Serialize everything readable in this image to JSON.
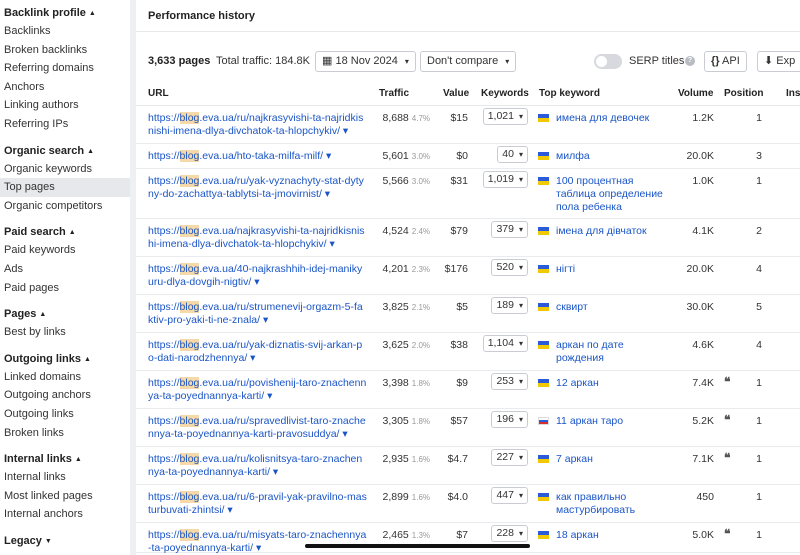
{
  "sidebar": [
    {
      "heading": "Backlink profile",
      "items": [
        "Backlinks",
        "Broken backlinks",
        "Referring domains",
        "Anchors",
        "Linking authors",
        "Referring IPs"
      ]
    },
    {
      "heading": "Organic search",
      "items": [
        "Organic keywords",
        "Top pages",
        "Organic competitors"
      ]
    },
    {
      "heading": "Paid search",
      "items": [
        "Paid keywords",
        "Ads",
        "Paid pages"
      ]
    },
    {
      "heading": "Pages",
      "items": [
        "Best by links"
      ]
    },
    {
      "heading": "Outgoing links",
      "items": [
        "Linked domains",
        "Outgoing anchors",
        "Outgoing links",
        "Broken links"
      ]
    },
    {
      "heading": "Internal links",
      "items": [
        "Internal links",
        "Most linked pages",
        "Internal anchors"
      ]
    },
    {
      "heading": "Legacy",
      "items": []
    }
  ],
  "active_item": "Top pages",
  "perf_title": "Performance history",
  "toolbar": {
    "pages": "3,633 pages",
    "traffic": "Total traffic: 184.8K",
    "date": "18 Nov 2024",
    "compare": "Don't compare",
    "serp": "SERP titles",
    "api": "API",
    "export": "Exp"
  },
  "columns": [
    "URL",
    "Traffic",
    "Value",
    "Keywords",
    "Top keyword",
    "Volume",
    "Position",
    "Ins"
  ],
  "rows": [
    {
      "url_pre": "https://",
      "url_hl": "blog",
      "url_rest": ".eva.ua/ru/najkrasyvishi-ta-najridkisnishi-imena-dlya-divchatok-ta-hlopchykiv/",
      "traffic": "8,688",
      "pct": "4.7%",
      "value": "$15",
      "keywords": "1,021",
      "flag": "ua",
      "top_kw": "имена для девочек",
      "volume": "1.2K",
      "quote": "",
      "position": "1"
    },
    {
      "url_pre": "https://",
      "url_hl": "blog",
      "url_rest": ".eva.ua/hto-taka-milfa-milf/",
      "traffic": "5,601",
      "pct": "3.0%",
      "value": "$0",
      "keywords": "40",
      "flag": "ua",
      "top_kw": "милфа",
      "volume": "20.0K",
      "quote": "",
      "position": "3"
    },
    {
      "url_pre": "https://",
      "url_hl": "blog",
      "url_rest": ".eva.ua/ru/yak-vyznachyty-stat-dytyny-do-zachattya-tablytsi-ta-jmovirnist/",
      "traffic": "5,566",
      "pct": "3.0%",
      "value": "$31",
      "keywords": "1,019",
      "flag": "ua",
      "top_kw": "100 процентная таблица определение пола ребенка",
      "volume": "1.0K",
      "quote": "",
      "position": "1"
    },
    {
      "url_pre": "https://",
      "url_hl": "blog",
      "url_rest": ".eva.ua/najkrasyvishi-ta-najridkisnishi-imena-dlya-divchatok-ta-hlopchykiv/",
      "traffic": "4,524",
      "pct": "2.4%",
      "value": "$79",
      "keywords": "379",
      "flag": "ua",
      "top_kw": "імена для дівчаток",
      "volume": "4.1K",
      "quote": "",
      "position": "2"
    },
    {
      "url_pre": "https://",
      "url_hl": "blog",
      "url_rest": ".eva.ua/40-najkrashhih-idej-manikyuru-dlya-dovgih-nigtiv/",
      "traffic": "4,201",
      "pct": "2.3%",
      "value": "$176",
      "keywords": "520",
      "flag": "ua",
      "top_kw": "нігті",
      "volume": "20.0K",
      "quote": "",
      "position": "4"
    },
    {
      "url_pre": "https://",
      "url_hl": "blog",
      "url_rest": ".eva.ua/ru/strumenevij-orgazm-5-faktiv-pro-yaki-ti-ne-znala/",
      "traffic": "3,825",
      "pct": "2.1%",
      "value": "$5",
      "keywords": "189",
      "flag": "ua",
      "top_kw": "сквирт",
      "volume": "30.0K",
      "quote": "",
      "position": "5"
    },
    {
      "url_pre": "https://",
      "url_hl": "blog",
      "url_rest": ".eva.ua/ru/yak-diznatis-svij-arkan-po-dati-narodzhennya/",
      "traffic": "3,625",
      "pct": "2.0%",
      "value": "$38",
      "keywords": "1,104",
      "flag": "ua",
      "top_kw": "аркан по дате рождения",
      "volume": "4.6K",
      "quote": "",
      "position": "4"
    },
    {
      "url_pre": "https://",
      "url_hl": "blog",
      "url_rest": ".eva.ua/ru/povishenij-taro-znachennya-ta-poyednannya-karti/",
      "traffic": "3,398",
      "pct": "1.8%",
      "value": "$9",
      "keywords": "253",
      "flag": "ua",
      "top_kw": "12 аркан",
      "volume": "7.4K",
      "quote": "❝",
      "position": "1"
    },
    {
      "url_pre": "https://",
      "url_hl": "blog",
      "url_rest": ".eva.ua/ru/spravedlivist-taro-znachennya-ta-poyednannya-karti-pravosuddya/",
      "traffic": "3,305",
      "pct": "1.8%",
      "value": "$57",
      "keywords": "196",
      "flag": "ru",
      "top_kw": "11 аркан таро",
      "volume": "5.2K",
      "quote": "❝",
      "position": "1"
    },
    {
      "url_pre": "https://",
      "url_hl": "blog",
      "url_rest": ".eva.ua/ru/kolisnitsya-taro-znachennya-ta-poyednannya-karti/",
      "traffic": "2,935",
      "pct": "1.6%",
      "value": "$4.7",
      "keywords": "227",
      "flag": "ua",
      "top_kw": "7 аркан",
      "volume": "7.1K",
      "quote": "❝",
      "position": "1"
    },
    {
      "url_pre": "https://",
      "url_hl": "blog",
      "url_rest": ".eva.ua/ru/6-pravil-yak-pravilno-masturbuvati-zhintsi/",
      "traffic": "2,899",
      "pct": "1.6%",
      "value": "$4.0",
      "keywords": "447",
      "flag": "ua",
      "top_kw": "как правильно мастурбировать",
      "volume": "450",
      "quote": "",
      "position": "1"
    },
    {
      "url_pre": "https://",
      "url_hl": "blog",
      "url_rest": ".eva.ua/ru/misyats-taro-znachennya-ta-poyednannya-karti/",
      "traffic": "2,465",
      "pct": "1.3%",
      "value": "$7",
      "keywords": "228",
      "flag": "ua",
      "top_kw": "18 аркан",
      "volume": "5.0K",
      "quote": "❝",
      "position": "1"
    }
  ]
}
